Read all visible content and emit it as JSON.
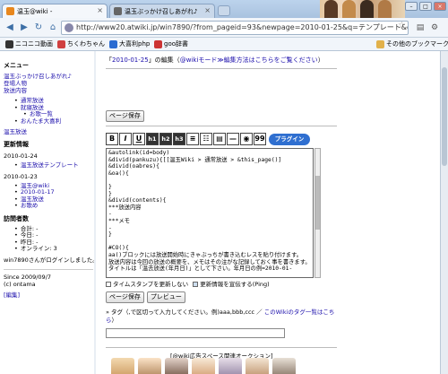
{
  "browser": {
    "tabs": [
      {
        "title": "温玉@wiki -",
        "color": "#e8871e"
      },
      {
        "title": "温玉ぶっかけ召しあがれ♪",
        "color": "#666666"
      }
    ],
    "url": "http://www20.atwiki.jp/win7890/?from_pageid=93&newpage=2010-01-25&q=テンプレート&cn",
    "bookmarks": [
      {
        "label": "ニコニコ動画",
        "color": "#333333"
      },
      {
        "label": "ちくわちゃん",
        "color": "#d04040"
      },
      {
        "label": "大喜利php",
        "color": "#2a6bd1"
      },
      {
        "label": "goo辞書",
        "color": "#cc3333"
      }
    ],
    "other_bookmarks": "その他のブックマーク"
  },
  "sidebar": {
    "menu_title": "メニュー",
    "menu_links": [
      "温玉ぶっかけ召しあがれ♪",
      "登場人物",
      "放送内容"
    ],
    "menu_list": [
      "通常放送",
      "就寝放送"
    ],
    "menu_sub": "お歌一覧",
    "menu_list2": [
      "おんたま大喜利"
    ],
    "other_link": "温玉放送",
    "updates_title": "更新情報",
    "dates": [
      {
        "date": "2010-01-24",
        "items": [
          "温玉放送テンプレート"
        ]
      },
      {
        "date": "2010-01-23",
        "items": [
          "温玉@wiki",
          "2010-01-17",
          "温玉放送",
          "お歌め"
        ]
      }
    ],
    "visitors_title": "訪問者数",
    "visitors": [
      "合計: -",
      "今日: -",
      "昨日: -",
      "オンライン: 3"
    ],
    "login_msg": "win7890さんがログインしました。",
    "since": "Since 2009/09/7",
    "copyright": "(c) ontama",
    "edit_link": "[編集]"
  },
  "main": {
    "topline_prefix": "「",
    "topline_link": "2010-01-25",
    "topline_mid": "」の編集（",
    "topline_link2": "@wikiモード≫編集方法はこちらをご覧ください",
    "topline_suffix": "）",
    "save_button": "ページ保存",
    "toolbar": [
      "B",
      "I",
      "U",
      "h1",
      "h2",
      "h3",
      "≡",
      "☷",
      "▤",
      "—",
      "◉",
      "99"
    ],
    "plugin_label": "プラグイン",
    "editor_text": "&autolink(id=body)\n&divid(pankuzu){[[温玉Wiki > 通常放送 > &this_page()]\n&divid(oabres){\n&oa(){\n\n}\n}\n&divid(contents){\n***放送内容\n-\n***メモ\n-\n}\n\n#CO(){\naa()ブロックには放送開始時にきゃぶっちが書き込むレスを貼り付けます。\n放送内容は今回の放送の概要を、メモはその注がな記録しておく事を書きます。\nタイトルは「温去放送(年月日)」として下さい。年月日の例=2010-01-"
  },
  "options": {
    "timestamp_label": "タイムスタンプを更新しない",
    "ping_label": "更新情報を宣伝する(Ping)",
    "save_button": "ページ保存",
    "preview_button": "プレビュー"
  },
  "tags": {
    "hint_prefix": "» タグ（,で区切って入力してください。例)aaa,bbb,ccc ／ ",
    "hint_link": "このWikiのタグ一覧はこちら",
    "hint_suffix": "）"
  },
  "ad_title": "[@wiki広告スペース関連オークション]"
}
